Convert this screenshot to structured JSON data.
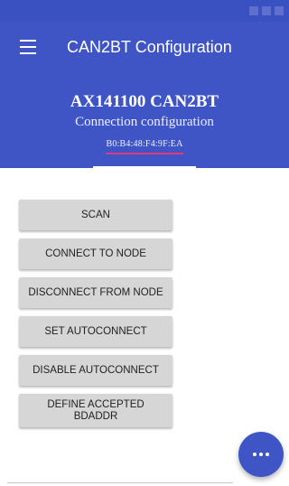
{
  "app_bar": {
    "title": "CAN2BT Configuration",
    "menu_icon": "hamburger-menu-icon"
  },
  "header": {
    "device_name": "AX141100 CAN2BT",
    "subtitle": "Connection configuration",
    "mac_address": "B0:B4:48:F4:9F:EA"
  },
  "buttons": {
    "scan": "SCAN",
    "connect": "CONNECT TO NODE",
    "disconnect": "DISCONNECT FROM NODE",
    "set_autoconnect": "SET AUTOCONNECT",
    "disable_autoconnect": "DISABLE AUTOCONNECT",
    "define_bdaddr": "DEFINE ACCEPTED\nBDADDR"
  },
  "fab": {
    "icon": "more-horizontal-icon"
  },
  "colors": {
    "primary": "#3f55c6",
    "status_bar": "#3a51c1",
    "accent_underline": "#e53a78",
    "button_bg": "#d6d6d6"
  }
}
